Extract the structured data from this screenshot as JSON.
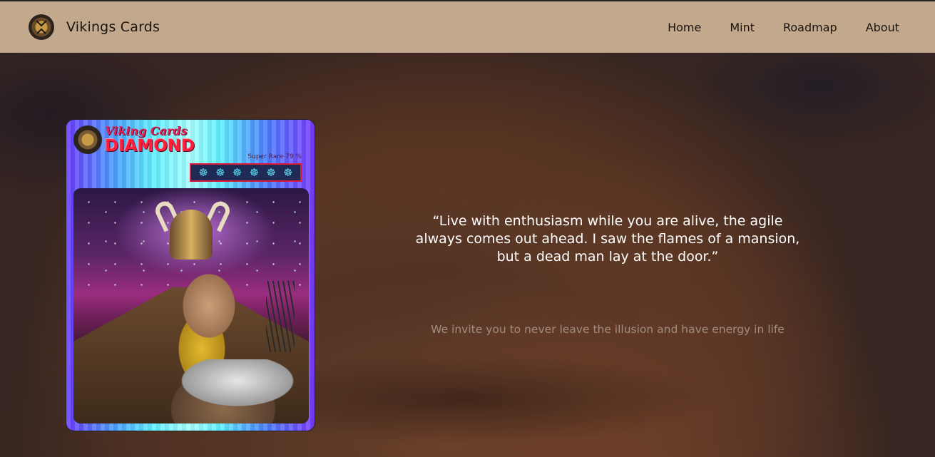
{
  "header": {
    "brand": "Vikings Cards",
    "logo_icon": "viking-shield-icon",
    "nav": [
      {
        "label": "Home"
      },
      {
        "label": "Mint"
      },
      {
        "label": "Roadmap"
      },
      {
        "label": "About"
      }
    ],
    "background_color": "#c2a98d"
  },
  "hero": {
    "card": {
      "title": "Viking Cards",
      "tier": "DIAMOND",
      "rarity": "Super Rare 79 %",
      "rating_icons": [
        "ship-wheel-icon",
        "ship-wheel-icon",
        "ship-wheel-icon",
        "ship-wheel-icon",
        "ship-wheel-icon",
        "ship-wheel-icon"
      ],
      "rating_count": 6
    },
    "quote": "“Live with enthusiasm while you are alive, the agile always comes out ahead. I saw the flames of a mansion, but a dead man lay at the door.”",
    "subtitle": "We invite you to never leave the illusion and have energy in life"
  }
}
